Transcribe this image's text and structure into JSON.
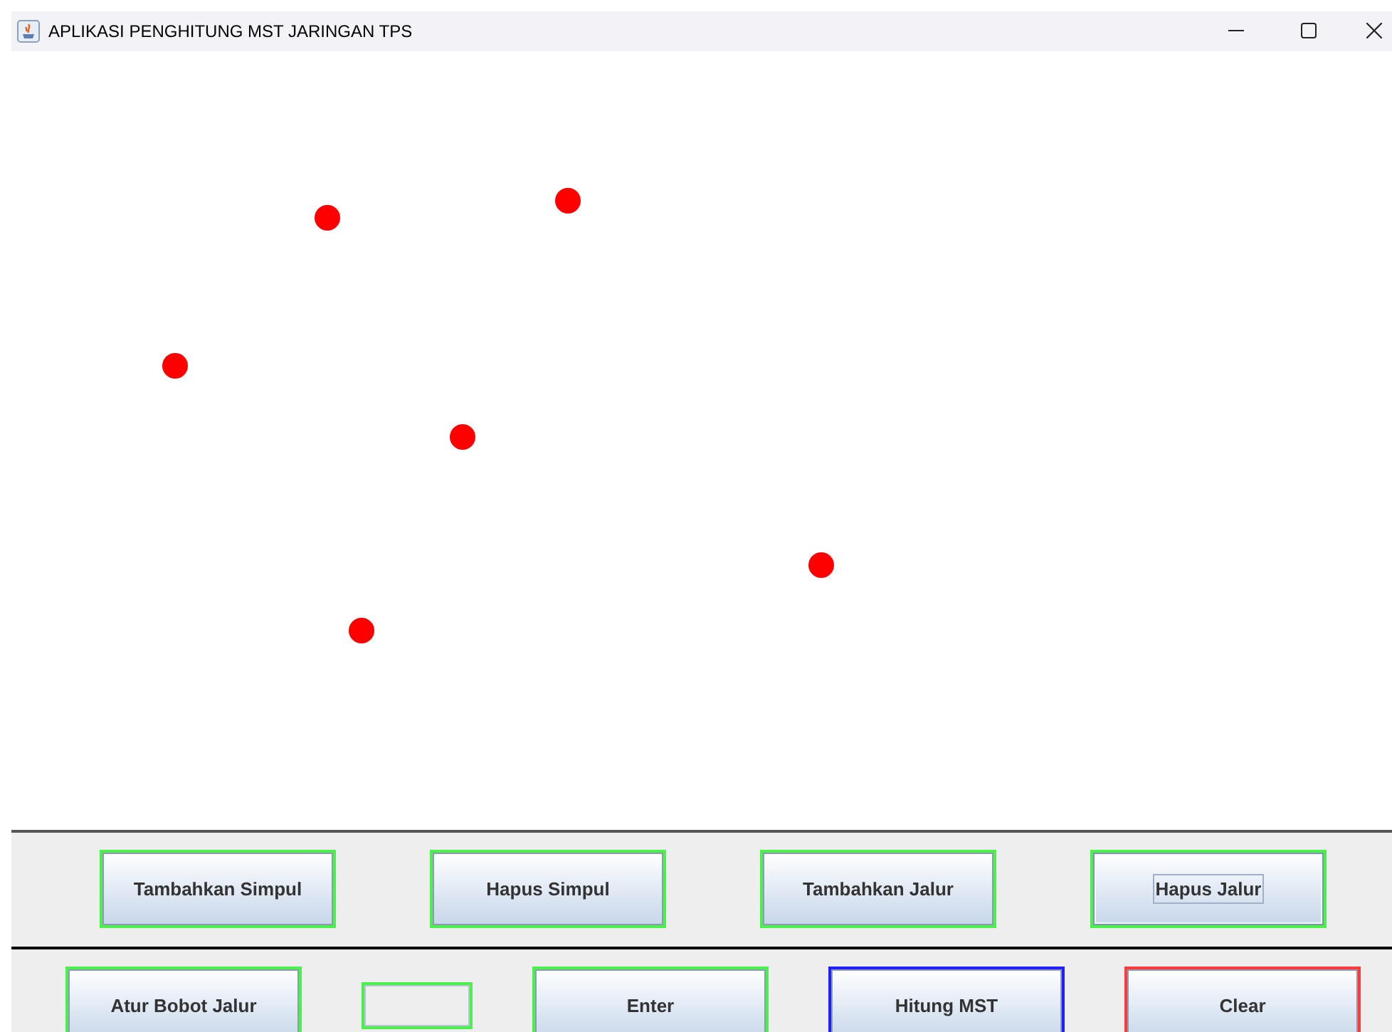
{
  "window": {
    "title": "APLIKASI PENGHITUNG MST JARINGAN TPS"
  },
  "nodes": [
    {
      "kind": "vertex"
    },
    {
      "kind": "vertex"
    },
    {
      "kind": "vertex"
    },
    {
      "kind": "vertex"
    },
    {
      "kind": "vertex"
    },
    {
      "kind": "vertex"
    }
  ],
  "toolbar_row_1": [
    {
      "kind": "button",
      "label": "Tambahkan Simpul",
      "color": "#4cf04c",
      "focused": false
    },
    {
      "kind": "button",
      "label": "Hapus Simpul",
      "color": "#4cf04c",
      "focused": false
    },
    {
      "kind": "button",
      "label": "Tambahkan Jalur",
      "color": "#4cf04c",
      "focused": false
    },
    {
      "kind": "button",
      "label": "Hapus Jalur",
      "color": "#4cf04c",
      "focused": true
    }
  ],
  "toolbar_row_2": [
    {
      "kind": "button",
      "label": "Atur Bobot Jalur",
      "color": "#4cf04c",
      "focused": false
    },
    {
      "kind": "field",
      "color": "#4cf04c"
    },
    {
      "kind": "button",
      "label": "Enter",
      "color": "#4cf04c",
      "focused": false
    },
    {
      "kind": "button",
      "label": "Hitung MST",
      "color": "#2020ff",
      "focused": false
    },
    {
      "kind": "button",
      "label": "Clear",
      "color": "#ff3a3a",
      "focused": false
    }
  ]
}
